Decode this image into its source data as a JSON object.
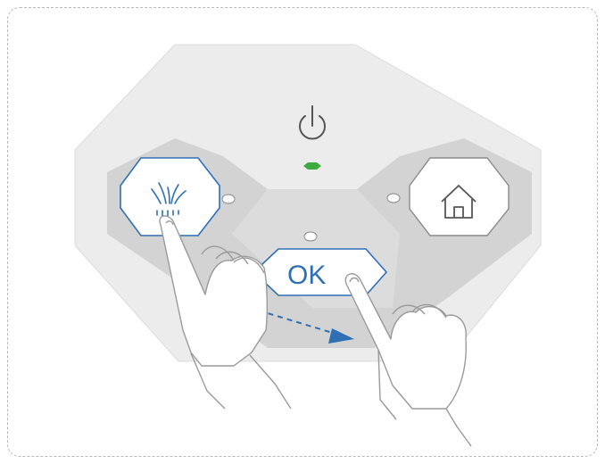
{
  "panel": {
    "ok_button": {
      "label": "OK"
    },
    "grass_button": {
      "icon": "grass-icon"
    },
    "home_button": {
      "icon": "home-icon"
    },
    "power": {
      "icon": "power-icon",
      "led_color": "#3faa3f"
    },
    "indicator_leds": [
      "left-led",
      "center-led",
      "right-led"
    ]
  },
  "gesture": {
    "arrow_color": "#2f6fb3",
    "hands": [
      "left-hand",
      "right-hand"
    ]
  },
  "colors": {
    "accent": "#2f6fb3",
    "panel_outer": "#ececec",
    "panel_inner": "#d3d3d3",
    "frame": "#b9b9b9"
  }
}
